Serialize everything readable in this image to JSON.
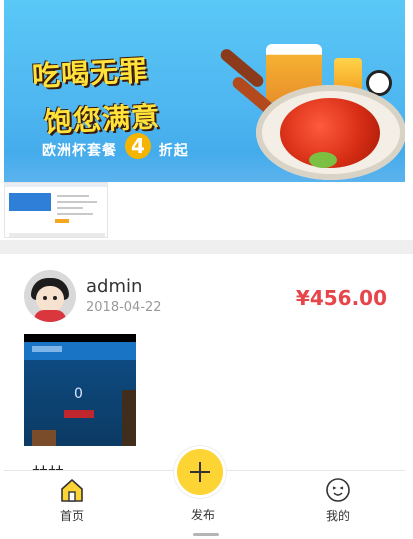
{
  "banner": {
    "line1": "吃喝无罪",
    "line2": "饱您满意",
    "line3_prefix": "欧洲杯套餐",
    "line3_number": "4",
    "line3_suffix": "折起"
  },
  "post": {
    "username": "admin",
    "date": "2018-04-22",
    "price": "¥456.00",
    "image_zero": "0",
    "cut_text": "林林"
  },
  "bottom_nav": {
    "home_label": "首页",
    "publish_label": "发布",
    "mine_label": "我的",
    "home_icon": "home-icon",
    "publish_icon": "plus-icon",
    "mine_icon": "face-icon"
  },
  "colors": {
    "price": "#e6454a",
    "publish_button": "#fcd535",
    "banner_sky": "#5ac8f7"
  }
}
